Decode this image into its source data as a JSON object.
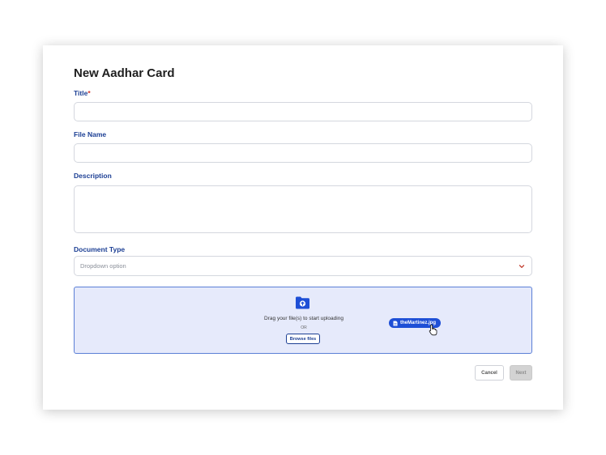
{
  "form": {
    "heading": "New Aadhar Card",
    "title_label": "Title",
    "required_mark": "*",
    "title_value": "",
    "file_name_label": "File Name",
    "file_name_value": "",
    "description_label": "Description",
    "description_value": "",
    "document_type_label": "Document Type",
    "document_type_placeholder": "Dropdown option"
  },
  "upload": {
    "drag_text": "Drag your file(s) to start uploading",
    "or_text": "OR",
    "browse_label": "Browse files",
    "dragged_file": "theMartinez.jpg",
    "folder_icon": "folder-upload-icon"
  },
  "actions": {
    "cancel_label": "Cancel",
    "next_label": "Next"
  },
  "colors": {
    "label": "#1c3f94",
    "required": "#d0342c",
    "dropzone_bg": "#e6eafb",
    "dropzone_border": "#5b7fd6",
    "chip": "#1e4fd6"
  }
}
